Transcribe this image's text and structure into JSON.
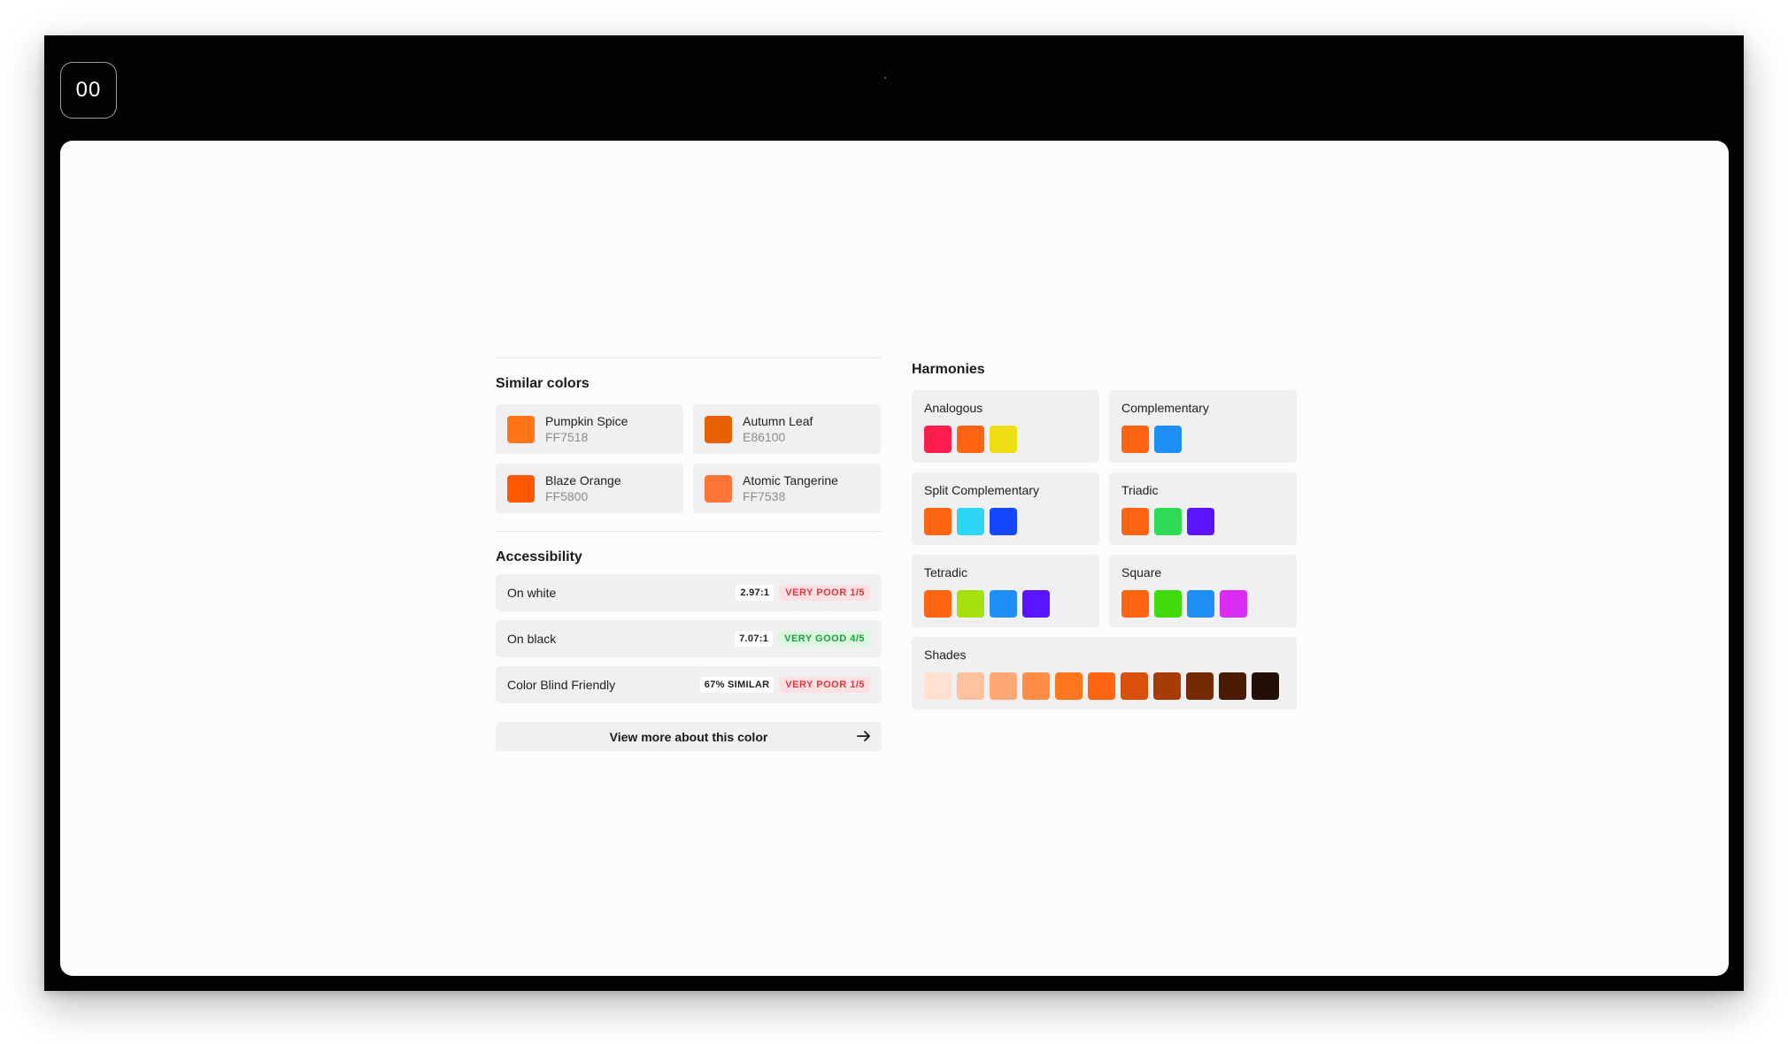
{
  "header": {
    "logo_text": "00"
  },
  "similar": {
    "title": "Similar colors",
    "items": [
      {
        "name": "Pumpkin Spice",
        "hex": "FF7518",
        "color": "#FF7518"
      },
      {
        "name": "Autumn Leaf",
        "hex": "E86100",
        "color": "#E86100"
      },
      {
        "name": "Blaze Orange",
        "hex": "FF5800",
        "color": "#FF5800"
      },
      {
        "name": "Atomic Tangerine",
        "hex": "FF7538",
        "color": "#FF7538"
      }
    ]
  },
  "accessibility": {
    "title": "Accessibility",
    "rows": [
      {
        "label": "On white",
        "ratio": "2.97:1",
        "rating": "VERY POOR 1/5",
        "status": "bad"
      },
      {
        "label": "On black",
        "ratio": "7.07:1",
        "rating": "VERY GOOD 4/5",
        "status": "good"
      },
      {
        "label": "Color Blind Friendly",
        "ratio": "67% SIMILAR",
        "rating": "VERY POOR 1/5",
        "status": "bad"
      }
    ]
  },
  "cta": {
    "label": "View more about this color",
    "icon": "arrow-right-icon"
  },
  "harmonies": {
    "title": "Harmonies",
    "groups": [
      {
        "name": "Analogous",
        "key": "analogous",
        "colors": [
          "#FF1E4F",
          "#FF6411",
          "#EDDF14"
        ]
      },
      {
        "name": "Complementary",
        "key": "complementary",
        "colors": [
          "#FF6411",
          "#1F8EF5"
        ]
      },
      {
        "name": "Split Complementary",
        "key": "split-complementary",
        "colors": [
          "#FF6411",
          "#2DD6F5",
          "#1448FF"
        ]
      },
      {
        "name": "Triadic",
        "key": "triadic",
        "colors": [
          "#FF6411",
          "#2DDB55",
          "#5A14FF"
        ]
      },
      {
        "name": "Tetradic",
        "key": "tetradic",
        "colors": [
          "#FF6411",
          "#A5E00F",
          "#1F8EF5",
          "#5A14FF"
        ]
      },
      {
        "name": "Square",
        "key": "square",
        "colors": [
          "#FF6411",
          "#3FDB0C",
          "#1F8EF5",
          "#DA2BF2"
        ]
      },
      {
        "name": "Shades",
        "key": "shades",
        "colors": [
          "#FFE1D1",
          "#FFC2A0",
          "#FFA775",
          "#FF8D47",
          "#FF781F",
          "#FF6411",
          "#D9500A",
          "#A63C06",
          "#752A04",
          "#4A1B03",
          "#221008"
        ]
      }
    ]
  }
}
